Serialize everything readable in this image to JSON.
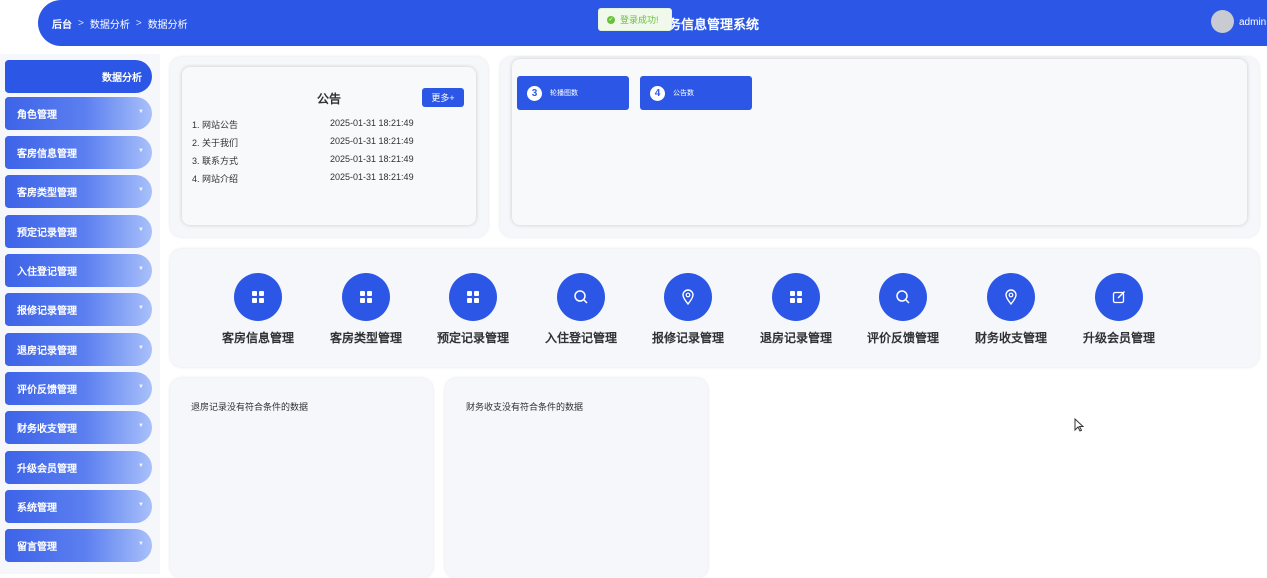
{
  "header": {
    "breadcrumb": [
      "后台",
      "数据分析",
      "数据分析"
    ],
    "title": "务信息管理系统",
    "username": "admin"
  },
  "toast": {
    "message": "登录成功!"
  },
  "sidebar": {
    "active": "数据分析",
    "items": [
      "角色管理",
      "客房信息管理",
      "客房类型管理",
      "预定记录管理",
      "入住登记管理",
      "报修记录管理",
      "退房记录管理",
      "评价反馈管理",
      "财务收支管理",
      "升级会员管理",
      "系统管理",
      "留言管理"
    ]
  },
  "notice": {
    "title": "公告",
    "more_label": "更多+",
    "rows": [
      {
        "title": "1. 网站公告",
        "time": "2025-01-31 18:21:49"
      },
      {
        "title": "2. 关于我们",
        "time": "2025-01-31 18:21:49"
      },
      {
        "title": "3. 联系方式",
        "time": "2025-01-31 18:21:49"
      },
      {
        "title": "4. 网站介绍",
        "time": "2025-01-31 18:21:49"
      }
    ]
  },
  "stats": [
    {
      "count": "3",
      "label": "轮播图数"
    },
    {
      "count": "4",
      "label": "公告数"
    }
  ],
  "quick_menu": [
    {
      "label": "客房信息管理",
      "icon": "grid-icon"
    },
    {
      "label": "客房类型管理",
      "icon": "grid-icon"
    },
    {
      "label": "预定记录管理",
      "icon": "grid-icon"
    },
    {
      "label": "入住登记管理",
      "icon": "search-icon"
    },
    {
      "label": "报修记录管理",
      "icon": "location-pin-icon"
    },
    {
      "label": "退房记录管理",
      "icon": "grid-icon"
    },
    {
      "label": "评价反馈管理",
      "icon": "search-icon"
    },
    {
      "label": "财务收支管理",
      "icon": "location-pin-icon"
    },
    {
      "label": "升级会员管理",
      "icon": "edit-icon"
    }
  ],
  "panels": [
    {
      "message": "退房记录没有符合条件的数据"
    },
    {
      "message": "财务收支没有符合条件的数据"
    }
  ],
  "colors": {
    "primary": "#2c57e6",
    "success": "#67c23a",
    "panel_bg": "#f6f7fa"
  }
}
